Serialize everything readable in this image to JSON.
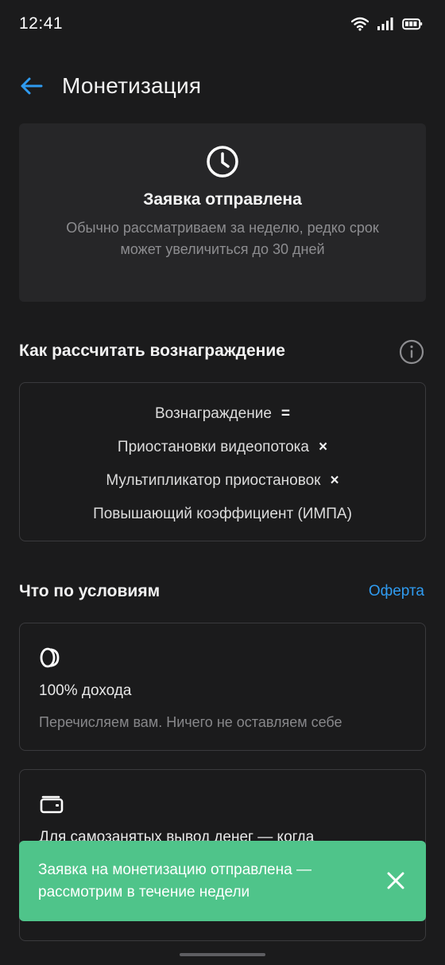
{
  "status_bar": {
    "time": "12:41"
  },
  "app_bar": {
    "title": "Монетизация",
    "back_icon": "arrow-left-icon",
    "accent_color": "#2f9bf0"
  },
  "application_status": {
    "icon": "clock-icon",
    "title": "Заявка отправлена",
    "description": "Обычно рассматриваем за неделю, редко срок может увеличиться до 30 дней"
  },
  "reward_section": {
    "title": "Как рассчитать вознаграждение",
    "info_icon": "info-icon",
    "formula": [
      {
        "text": "Вознаграждение",
        "operator": "="
      },
      {
        "text": "Приостановки видеопотока",
        "operator": "×"
      },
      {
        "text": "Мультипликатор приостановок",
        "operator": "×"
      },
      {
        "text": "Повышающий коэффициент (ИМПА)",
        "operator": ""
      }
    ]
  },
  "terms_section": {
    "title": "Что по условиям",
    "offer_link": "Оферта",
    "cards": [
      {
        "icon": "coins-icon",
        "title": "100% дохода",
        "description": "Перечисляем вам. Ничего не оставляем себе"
      },
      {
        "icon": "wallet-icon",
        "title": "Для самозанятых вывод денег — когда"
      }
    ]
  },
  "toast": {
    "message": "Заявка на монетизацию отправлена — рассмотрим в течение недели",
    "close_icon": "close-icon",
    "color": "#4fc48a"
  }
}
